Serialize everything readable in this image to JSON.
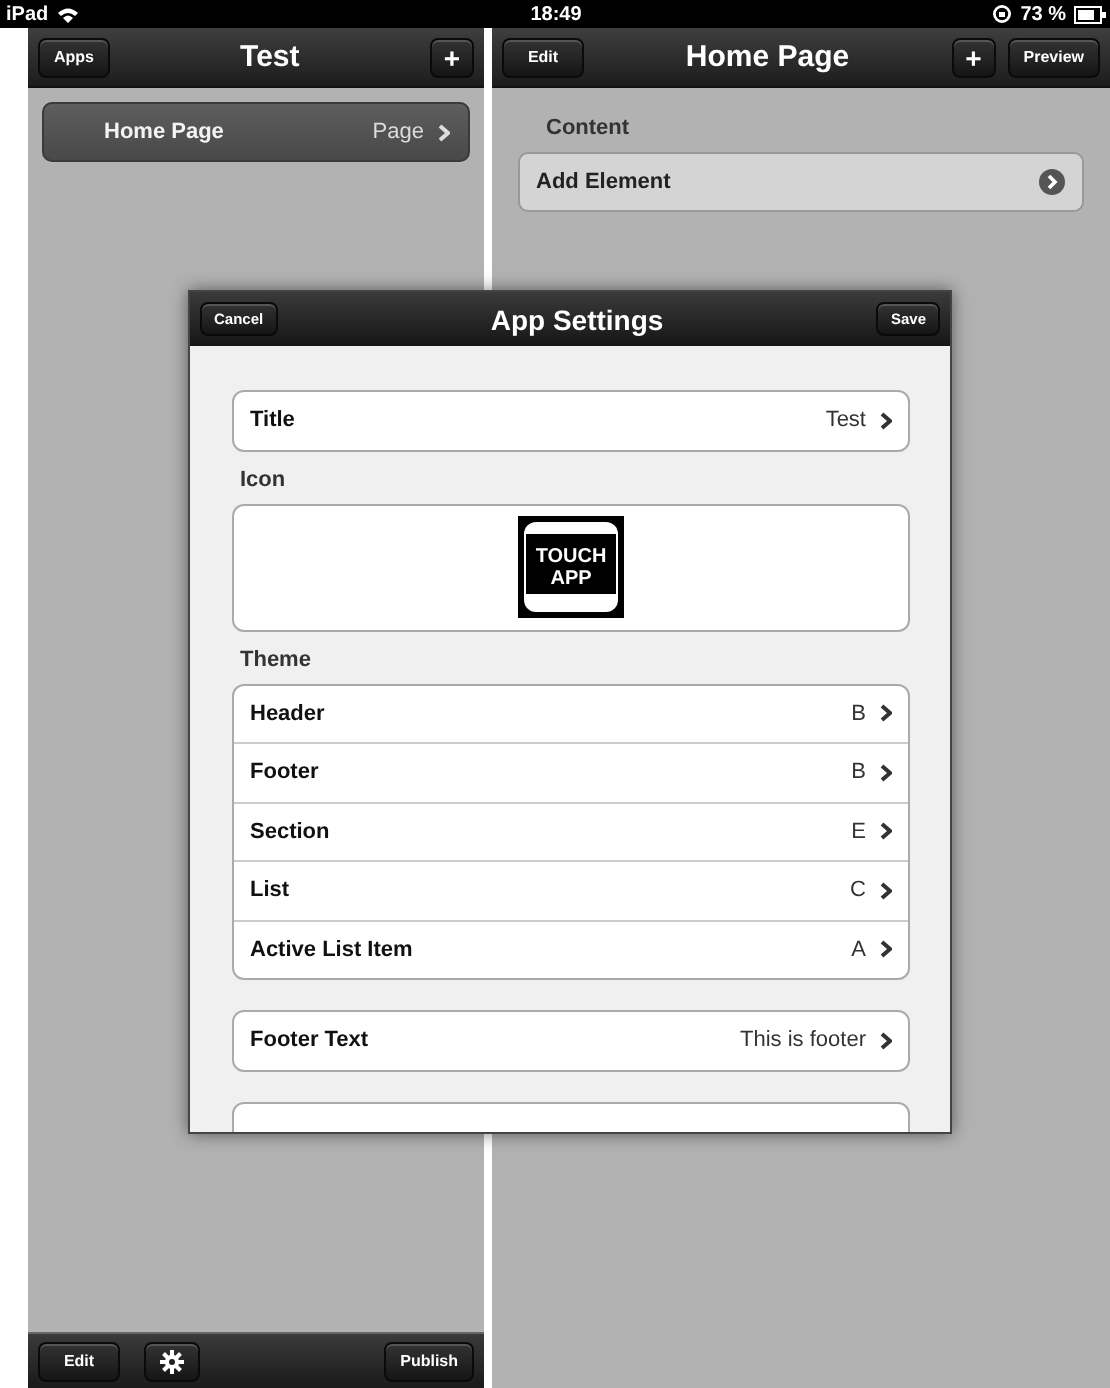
{
  "status_bar": {
    "device": "iPad",
    "time": "18:49",
    "battery": "73 %"
  },
  "left_pane": {
    "header": {
      "left_button": "Apps",
      "title": "Test",
      "right_button": "+"
    },
    "items": [
      {
        "title": "Home Page",
        "detail": "Page",
        "selected": true
      }
    ],
    "toolbar": {
      "left_button": "Edit",
      "right_button": "Publish"
    }
  },
  "right_pane": {
    "header": {
      "left_button": "Edit",
      "title": "Home Page",
      "buttons": [
        "+",
        "Preview"
      ]
    },
    "section": "Content",
    "items": [
      {
        "label": "Add Element"
      }
    ]
  },
  "dialog": {
    "title": "App Settings",
    "cancel": "Cancel",
    "save": "Save",
    "sections": [
      {
        "kind": "rows",
        "rows": [
          {
            "label": "Title",
            "value": "Test"
          }
        ]
      },
      {
        "kind": "icon",
        "label": "Icon",
        "icon_lines": [
          "TOUCH",
          "APP"
        ]
      },
      {
        "kind": "rows",
        "label": "Theme",
        "rows": [
          {
            "label": "Header",
            "value": "B"
          },
          {
            "label": "Footer",
            "value": "B"
          },
          {
            "label": "Section",
            "value": "E"
          },
          {
            "label": "List",
            "value": "C"
          },
          {
            "label": "Active List Item",
            "value": "A"
          }
        ]
      },
      {
        "kind": "rows",
        "rows": [
          {
            "label": "Footer Text",
            "value": "This is footer"
          }
        ]
      }
    ]
  }
}
